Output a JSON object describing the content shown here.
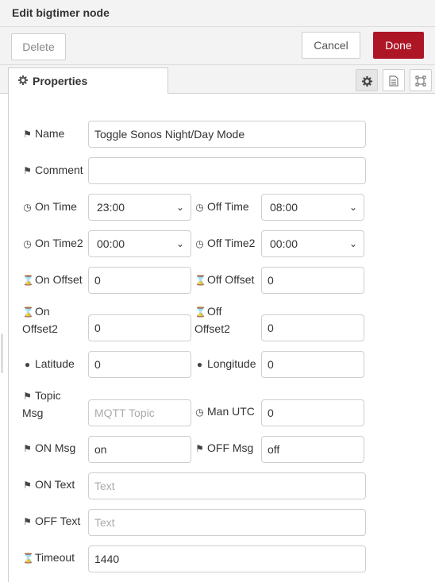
{
  "window": {
    "title": "Edit bigtimer node"
  },
  "toolbar": {
    "delete_label": "Delete",
    "cancel_label": "Cancel",
    "done_label": "Done"
  },
  "tabs": {
    "properties_label": "Properties"
  },
  "icons": {
    "settings": "gear-icon",
    "description": "document-icon",
    "appearance": "frame-icon"
  },
  "form": {
    "name": {
      "label": "Name",
      "value": "Toggle Sonos Night/Day Mode"
    },
    "comment": {
      "label": "Comment",
      "value": ""
    },
    "on_time": {
      "label": "On Time",
      "value": "23:00"
    },
    "off_time": {
      "label": "Off Time",
      "value": "08:00"
    },
    "on_time2": {
      "label": "On Time2",
      "value": "00:00"
    },
    "off_time2": {
      "label": "Off Time2",
      "value": "00:00"
    },
    "on_offset": {
      "label": "On Offset",
      "value": "0"
    },
    "off_offset": {
      "label": "Off Offset",
      "value": "0"
    },
    "on_offset2": {
      "label_line1": "On",
      "label_line2": "Offset2",
      "value": "0"
    },
    "off_offset2": {
      "label_line1": "Off",
      "label_line2": "Offset2",
      "value": "0"
    },
    "latitude": {
      "label": "Latitude",
      "value": "0"
    },
    "longitude": {
      "label": "Longitude",
      "value": "0"
    },
    "topic_msg": {
      "label_line1": "Topic",
      "label_line2": "Msg",
      "placeholder": "MQTT Topic"
    },
    "man_utc": {
      "label": "Man UTC",
      "value": "0"
    },
    "on_msg": {
      "label": "ON Msg",
      "value": "on"
    },
    "off_msg": {
      "label": "OFF Msg",
      "value": "off"
    },
    "on_text": {
      "label": "ON Text",
      "placeholder": "Text"
    },
    "off_text": {
      "label": "OFF Text",
      "placeholder": "Text"
    },
    "timeout": {
      "label": "Timeout",
      "value": "1440"
    }
  },
  "colors": {
    "accent": "#ad1625",
    "panel_bg": "#f3f3f3",
    "border": "#cfcfcf"
  }
}
